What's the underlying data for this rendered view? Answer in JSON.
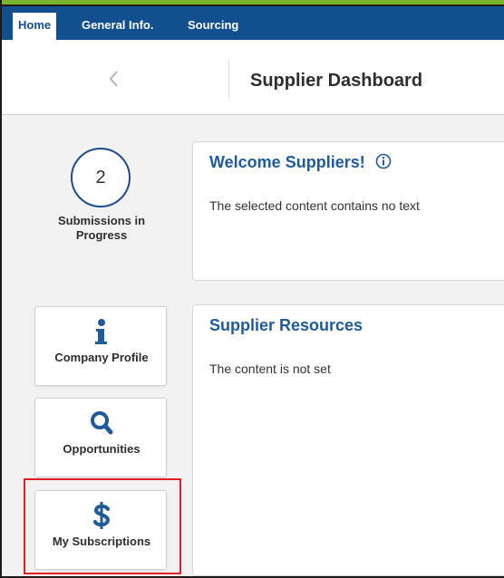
{
  "nav": {
    "tabs": [
      {
        "label": "Home",
        "active": true
      },
      {
        "label": "General Info.",
        "active": false
      },
      {
        "label": "Sourcing",
        "active": false
      }
    ]
  },
  "header": {
    "back_icon": "chevron-left-icon",
    "title": "Supplier Dashboard"
  },
  "sidebar": {
    "submissions_count": "2",
    "submissions_label": "Submissions in Progress",
    "tiles": [
      {
        "label": "Company Profile",
        "icon": "info-icon"
      },
      {
        "label": "Opportunities",
        "icon": "search-icon"
      },
      {
        "label": "My Subscriptions",
        "icon": "dollar-icon"
      }
    ]
  },
  "cards": {
    "welcome": {
      "title": "Welcome Suppliers!",
      "body": "The selected content contains no text",
      "icon": "info-circle-icon"
    },
    "resources": {
      "title": "Supplier Resources",
      "body": "The content is not set"
    }
  },
  "colors": {
    "nav_bg": "#114f8f",
    "accent_bar": "#7ab32e",
    "heading_blue": "#1f5a99",
    "highlight_red": "#e02020"
  }
}
